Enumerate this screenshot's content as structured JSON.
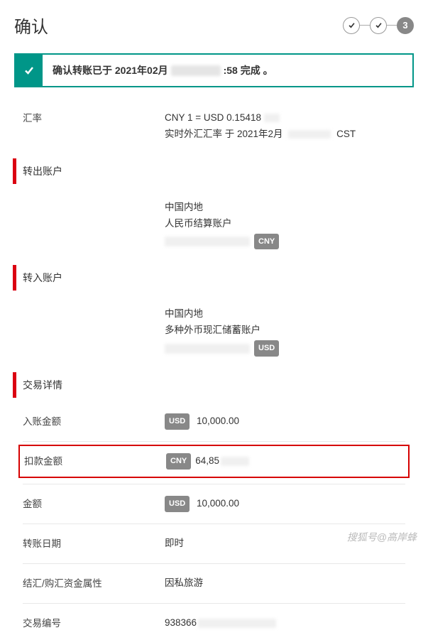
{
  "header": {
    "title": "确认",
    "step3_label": "3"
  },
  "banner": {
    "prefix": "确认转账已于 2021年02月",
    "time_suffix": ":58 完成 。"
  },
  "rate": {
    "label": "汇率",
    "line1": "CNY 1 = USD 0.15418",
    "line2_prefix": "实时外汇汇率 于 2021年2月",
    "line2_suffix": "CST"
  },
  "from_account": {
    "header": "转出账户",
    "region": "中国内地",
    "type": "人民币结算账户",
    "currency": "CNY"
  },
  "to_account": {
    "header": "转入账户",
    "region": "中国内地",
    "type": "多种外币现汇储蓄账户",
    "currency": "USD"
  },
  "details": {
    "header": "交易详情",
    "credit": {
      "label": "入账金额",
      "currency": "USD",
      "value": "10,000.00"
    },
    "debit": {
      "label": "扣款金额",
      "currency": "CNY",
      "value_prefix": "64,85"
    },
    "amount": {
      "label": "金额",
      "currency": "USD",
      "value": "10,000.00"
    },
    "date": {
      "label": "转账日期",
      "value": "即时"
    },
    "purpose": {
      "label": "结汇/购汇资金属性",
      "value": "因私旅游"
    },
    "txnid": {
      "label": "交易编号",
      "value_prefix": "938366"
    }
  },
  "watermark": "搜狐号@高岸蜂"
}
